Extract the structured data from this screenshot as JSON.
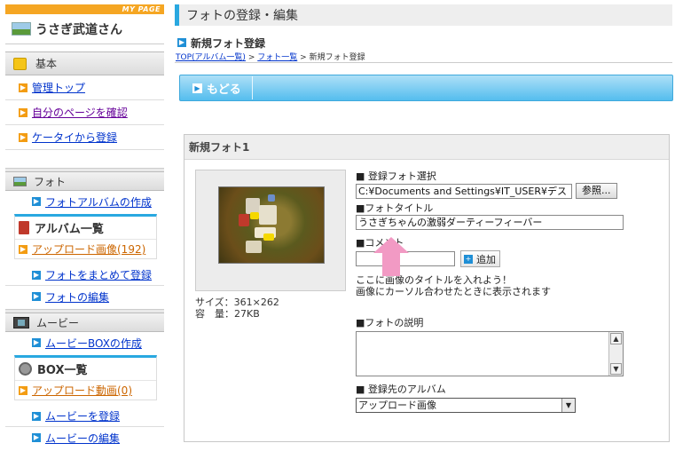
{
  "sidebar": {
    "mypage_label": "MY PAGE",
    "user_name": "うさぎ武道さん",
    "basic": {
      "title": "基本",
      "items": [
        "管理トップ",
        "自分のページを確認",
        "ケータイから登録"
      ]
    },
    "photo": {
      "title": "フォト",
      "create_album": "フォトアルバムの作成",
      "album_list_title": "アルバム一覧",
      "upload_album": "アップロード画像(192)",
      "bulk_register": "フォトをまとめて登録",
      "edit_photos": "フォトの編集"
    },
    "movie": {
      "title": "ムービー",
      "create_box": "ムービーBOXの作成",
      "box_list_title": "BOX一覧",
      "upload_movie": "アップロード動画(0)",
      "register_movie": "ムービーを登録",
      "edit_movie": "ムービーの編集"
    }
  },
  "main": {
    "page_title": "フォトの登録・編集",
    "sub_title": "新規フォト登録",
    "breadcrumb": {
      "home": "TOP(アルバム一覧)",
      "sep": ">",
      "photos": "フォト一覧",
      "current": "新規フォト登録"
    },
    "back_label": "もどる",
    "panel": {
      "title": "新規フォト1",
      "size_line": "サイズ：361×262",
      "capacity_line": "容　量：27KB",
      "file_label": "■ 登録フォト選択",
      "file_value": "C:¥Documents and Settings¥IT_USER¥デス",
      "browse_label": "参照...",
      "title_label": "■フォトタイトル",
      "title_value": "うさぎちゃんの激弱ダーティーフィーバー",
      "comment_label": "■コメント",
      "comment_value": "",
      "add_label": "追加",
      "hint_line1": "ここに画像のタイトルを入れよう！",
      "hint_line2": "画像にカーソル合わせたときに表示されます",
      "desc_label": "■フォトの説明",
      "desc_value": "",
      "album_label": "■ 登録先のアルバム",
      "album_value": "アップロード画像"
    }
  },
  "colors": {
    "accent_blue": "#29a8e0",
    "mypage_orange": "#f5a623",
    "annotation_pink": "#f29ac4"
  }
}
